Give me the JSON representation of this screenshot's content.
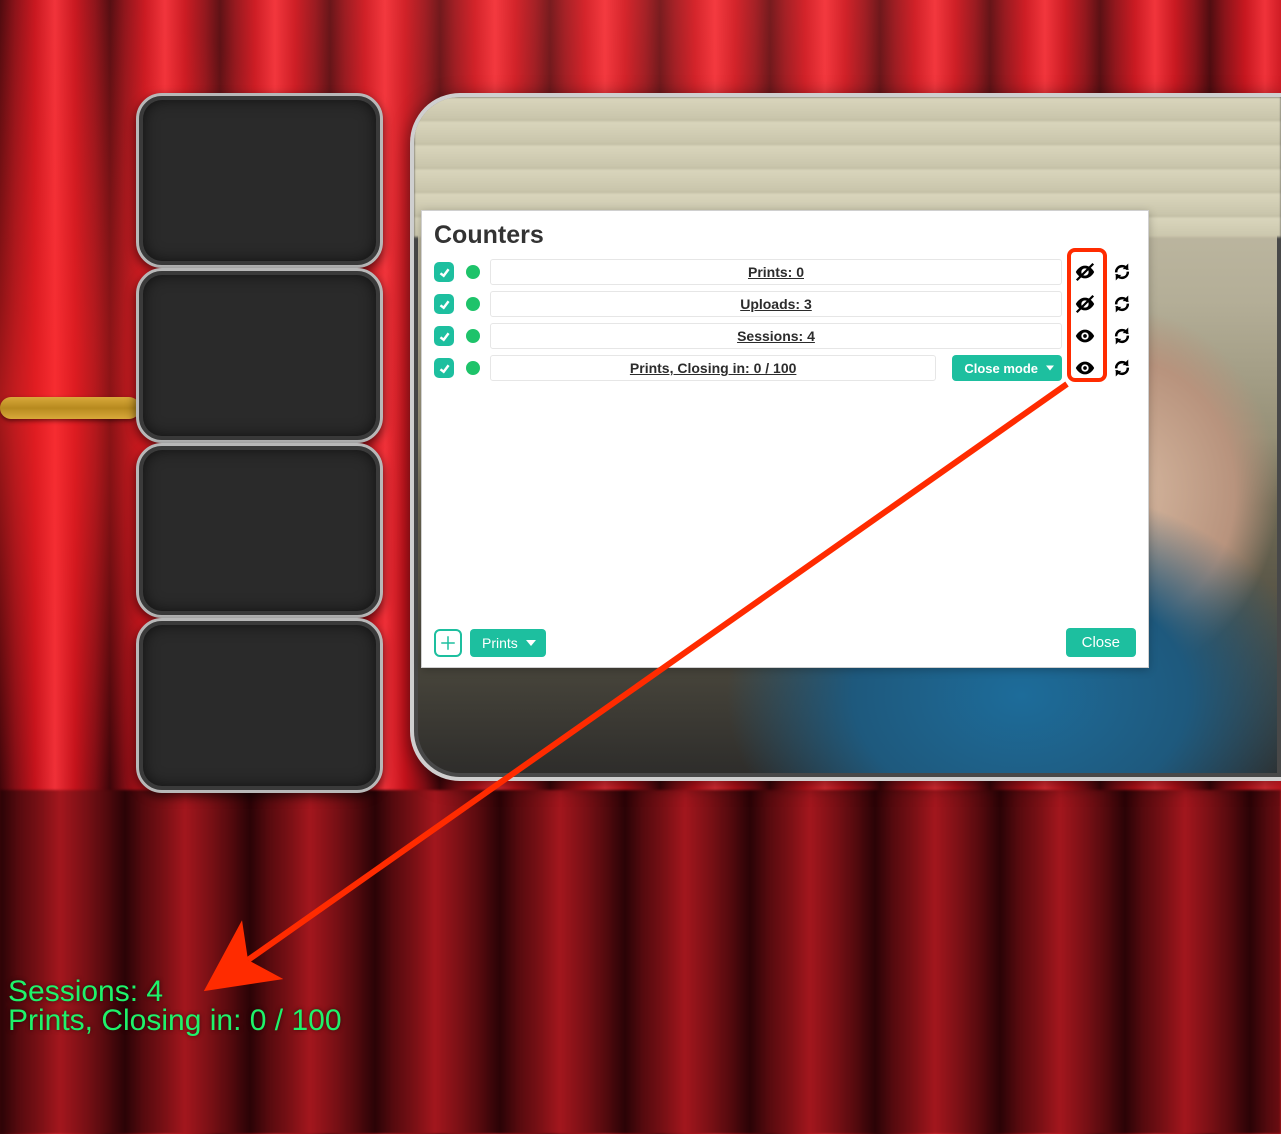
{
  "modal": {
    "title": "Counters",
    "rows": [
      {
        "label": "Prints: 0",
        "visible": false
      },
      {
        "label": "Uploads: 3",
        "visible": false
      },
      {
        "label": "Sessions: 4",
        "visible": true
      },
      {
        "label": "Prints, Closing in: 0 / 100",
        "visible": true,
        "mode": "Close mode"
      }
    ],
    "add_type": "Prints",
    "close_label": "Close"
  },
  "overlay": {
    "line1": "Sessions: 4",
    "line2": "Prints, Closing in: 0 / 100"
  },
  "colors": {
    "accent": "#1dbf9f",
    "annotation": "#ff2b00"
  }
}
